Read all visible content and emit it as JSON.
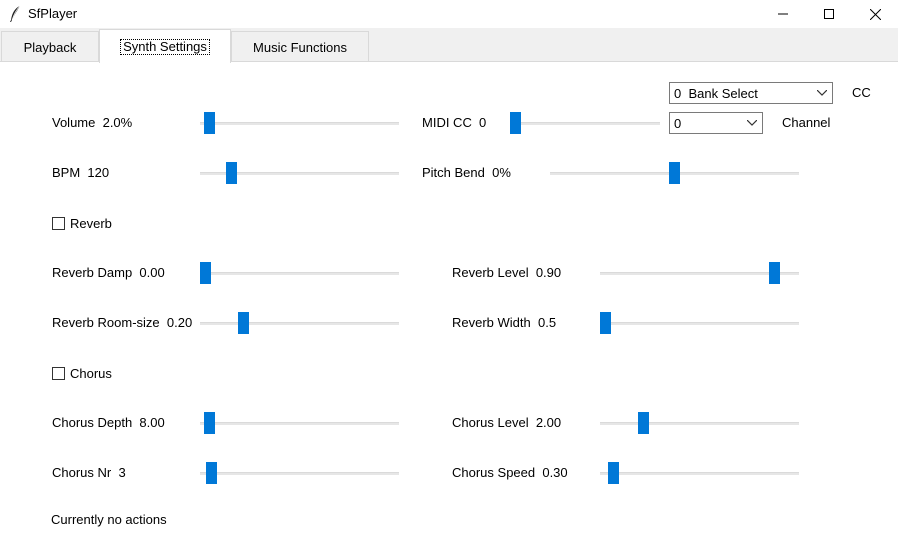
{
  "window": {
    "title": "SfPlayer"
  },
  "tabs": [
    {
      "label": "Playback"
    },
    {
      "label": "Synth Settings"
    },
    {
      "label": "Music Functions"
    }
  ],
  "controls": {
    "cc_combo": {
      "value": "0  Bank Select",
      "side_label": "CC"
    },
    "channel_combo": {
      "value": "0",
      "side_label": "Channel"
    },
    "sliders": {
      "volume": {
        "label": "Volume  2.0%",
        "level": 0.02
      },
      "midi_cc": {
        "label": "MIDI CC  0",
        "level": 0.0
      },
      "bpm": {
        "label": "BPM  120",
        "level": 0.14
      },
      "pitch_bend": {
        "label": "Pitch Bend  0%",
        "level": 0.5
      },
      "reverb_damp": {
        "label": "Reverb Damp  0.00",
        "level": 0.0
      },
      "reverb_level": {
        "label": "Reverb Level  0.90",
        "level": 0.9
      },
      "reverb_roomsize": {
        "label": "Reverb Room-size  0.20",
        "level": 0.2
      },
      "reverb_width": {
        "label": "Reverb Width  0.5",
        "level": 0.0
      },
      "chorus_depth": {
        "label": "Chorus Depth  8.00",
        "level": 0.02
      },
      "chorus_level": {
        "label": "Chorus Level  2.00",
        "level": 0.2
      },
      "chorus_nr": {
        "label": "Chorus Nr  3",
        "level": 0.03
      },
      "chorus_speed": {
        "label": "Chorus Speed  0.30",
        "level": 0.04
      }
    },
    "reverb_checkbox": {
      "label": "Reverb",
      "checked": false
    },
    "chorus_checkbox": {
      "label": "Chorus",
      "checked": false
    }
  },
  "status": {
    "text": "Currently no actions"
  },
  "colors": {
    "accent": "#0078d7",
    "track": "#e6e6e6",
    "tab_bar": "#f0f0f0"
  }
}
